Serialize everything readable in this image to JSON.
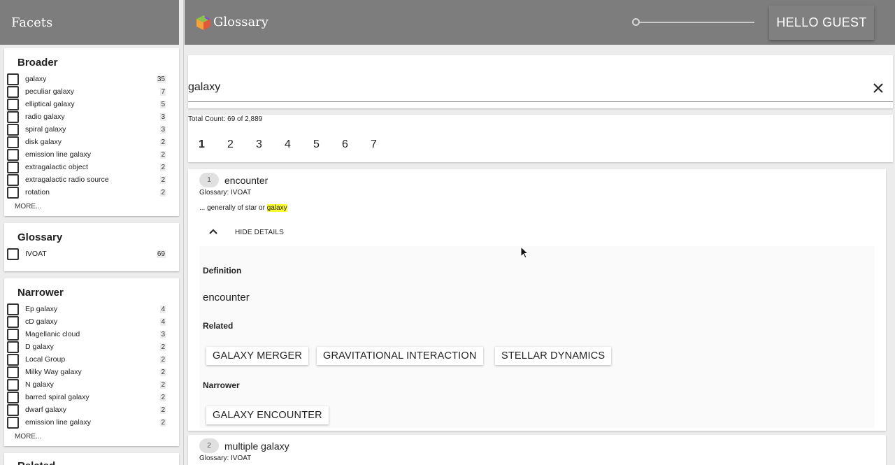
{
  "sidebar": {
    "title": "Facets",
    "facets": [
      {
        "title": "Broader",
        "items": [
          {
            "label": "galaxy",
            "count": "35"
          },
          {
            "label": "peculiar galaxy",
            "count": "7"
          },
          {
            "label": "elliptical galaxy",
            "count": "5"
          },
          {
            "label": "radio galaxy",
            "count": "3"
          },
          {
            "label": "spiral galaxy",
            "count": "3"
          },
          {
            "label": "disk galaxy",
            "count": "2"
          },
          {
            "label": "emission line galaxy",
            "count": "2"
          },
          {
            "label": "extragalactic object",
            "count": "2"
          },
          {
            "label": "extragalactic radio source",
            "count": "2"
          },
          {
            "label": "rotation",
            "count": "2"
          }
        ],
        "more": "MORE..."
      },
      {
        "title": "Glossary",
        "items": [
          {
            "label": "IVOAT",
            "count": "69"
          }
        ]
      },
      {
        "title": "Narrower",
        "items": [
          {
            "label": "Ep galaxy",
            "count": "4"
          },
          {
            "label": "cD galaxy",
            "count": "4"
          },
          {
            "label": "Magellanic cloud",
            "count": "3"
          },
          {
            "label": "D galaxy",
            "count": "2"
          },
          {
            "label": "Local Group",
            "count": "2"
          },
          {
            "label": "Milky Way galaxy",
            "count": "2"
          },
          {
            "label": "N galaxy",
            "count": "2"
          },
          {
            "label": "barred spiral galaxy",
            "count": "2"
          },
          {
            "label": "dwarf galaxy",
            "count": "2"
          },
          {
            "label": "emission line galaxy",
            "count": "2"
          }
        ],
        "more": "MORE..."
      },
      {
        "title": "Related"
      }
    ]
  },
  "header": {
    "title": "Glossary",
    "user_button": "HELLO GUEST"
  },
  "search": {
    "value": "galaxy"
  },
  "results_meta": {
    "total_count": "Total Count: 69 of 2,889",
    "pages": [
      "1",
      "2",
      "3",
      "4",
      "5",
      "6",
      "7"
    ],
    "active_page": "1"
  },
  "results": [
    {
      "rank": "1",
      "title": "encounter",
      "glossary": "Glossary: IVOAT",
      "snippet_prefix": "... generally of star or ",
      "snippet_highlight": "galaxy",
      "toggle_label": "HIDE DETAILS",
      "details": {
        "definition_heading": "Definition",
        "definition": "encounter",
        "related_heading": "Related",
        "related": [
          "GALAXY MERGER",
          "GRAVITATIONAL INTERACTION",
          "STELLAR DYNAMICS"
        ],
        "narrower_heading": "Narrower",
        "narrower": [
          "GALAXY ENCOUNTER"
        ]
      }
    },
    {
      "rank": "2",
      "title": "multiple galaxy",
      "glossary": "Glossary: IVOAT"
    }
  ],
  "colors": {
    "header_bg": "#7d7d7d",
    "highlight": "#ffff33",
    "page_bg": "#ececec"
  },
  "icons": [
    "logo-cube-icon",
    "close-icon",
    "chevron-up-icon",
    "checkbox-icon",
    "mouse-cursor-icon"
  ]
}
